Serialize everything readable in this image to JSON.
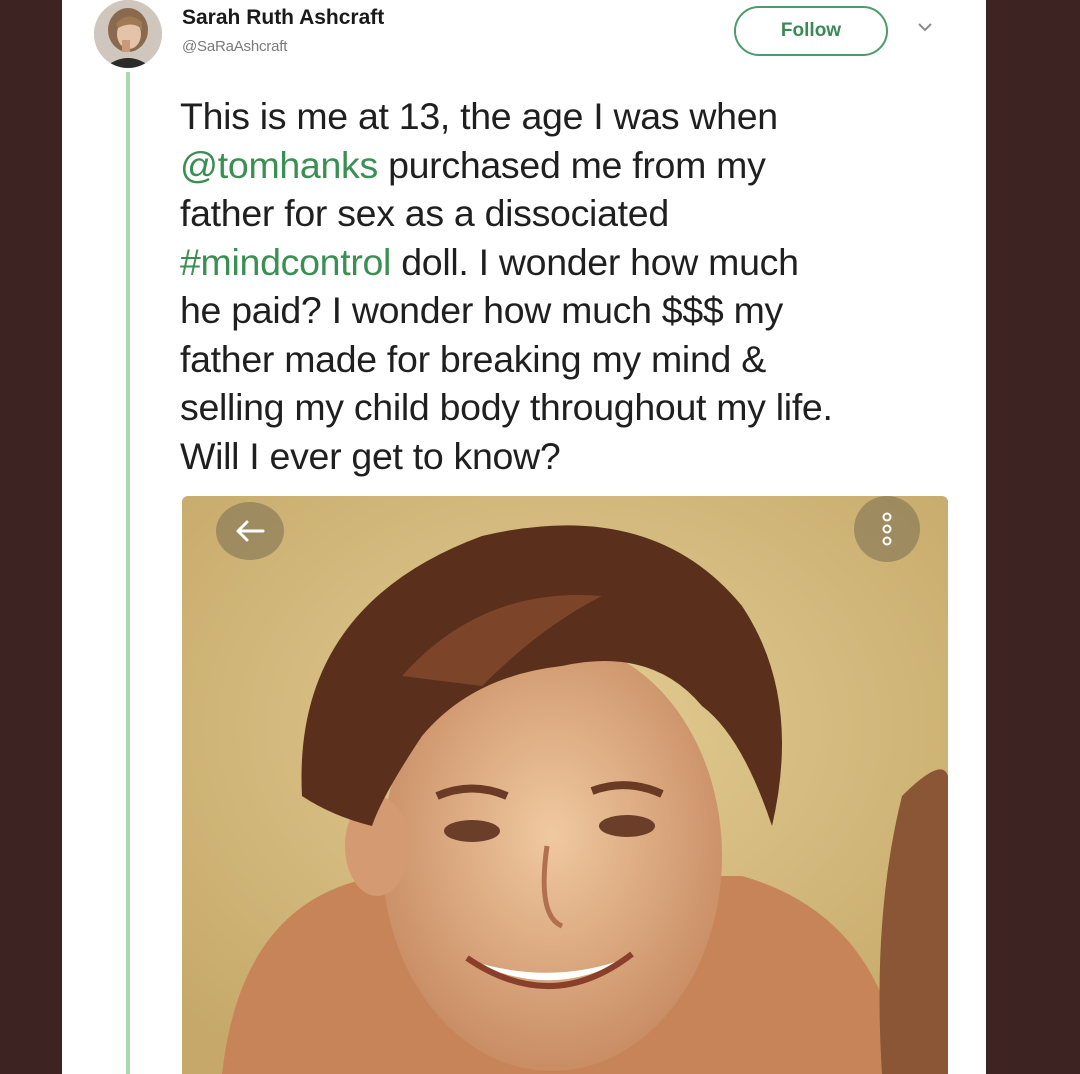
{
  "tweet": {
    "author_name": "Sarah Ruth Ashcraft",
    "author_handle": "@SaRaAshcraft",
    "follow_label": "Follow",
    "text_lines": [
      [
        {
          "t": "This is me at 13, the age I was when",
          "hl": false
        }
      ],
      [
        {
          "t": "@tomhanks",
          "hl": true
        },
        {
          "t": " purchased me from my",
          "hl": false
        }
      ],
      [
        {
          "t": "father for sex as a dissociated",
          "hl": false
        }
      ],
      [
        {
          "t": "#mindcontrol",
          "hl": true
        },
        {
          "t": " doll. I wonder how much",
          "hl": false
        }
      ],
      [
        {
          "t": "he paid? I wonder how much $$$ my",
          "hl": false
        }
      ],
      [
        {
          "t": "father made for breaking my mind &",
          "hl": false
        }
      ],
      [
        {
          "t": "selling my child body throughout my life.",
          "hl": false
        }
      ],
      [
        {
          "t": "Will I ever get to know?",
          "hl": false
        }
      ]
    ]
  },
  "media": {
    "back_icon": "arrow-left-icon",
    "more_icon": "more-vertical-icon"
  },
  "colors": {
    "background": "#3d2422",
    "accent_green": "#3a8f53",
    "thread_line": "#a9d6b3"
  }
}
